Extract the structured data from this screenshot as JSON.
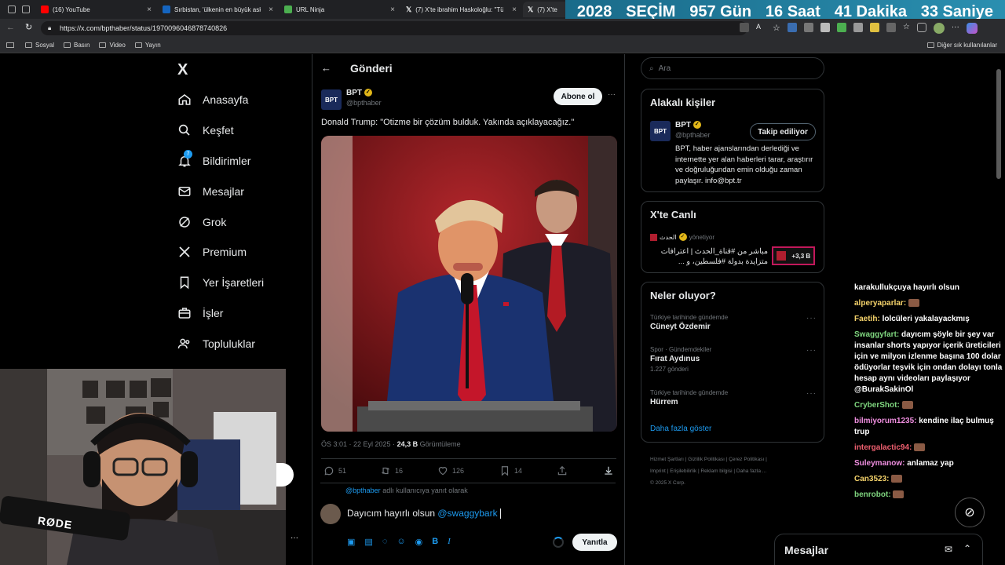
{
  "browser": {
    "tabs": [
      {
        "title": "(16) YouTube",
        "color": "#ff0000"
      },
      {
        "title": "Sırbistan, 'ülkenin en büyük askı",
        "color": "#1565c0"
      },
      {
        "title": "URL Ninja",
        "color": "#4caf50"
      },
      {
        "title": "(7) X'te ibrahim Haskoloğlu: \"Tü",
        "color": "#000000"
      },
      {
        "title": "(7) X'te",
        "color": "#000000"
      }
    ],
    "url": "https://x.com/bpthaber/status/1970096046878740826",
    "bookmarks": [
      "Sosyal",
      "Basın",
      "Video",
      "Yayın"
    ],
    "other_bookmarks": "Diğer sık kullanılanlar"
  },
  "countdown": {
    "year": "2028",
    "label": "SEÇİM",
    "days": "957 Gün",
    "hours": "16 Saat",
    "minutes": "41 Dakika",
    "seconds": "33 Saniye"
  },
  "nav": {
    "logo": "X",
    "items": [
      {
        "label": "Anasayfa",
        "icon": "home-icon"
      },
      {
        "label": "Keşfet",
        "icon": "search-icon"
      },
      {
        "label": "Bildirimler",
        "icon": "bell-icon",
        "badge": "7"
      },
      {
        "label": "Mesajlar",
        "icon": "mail-icon"
      },
      {
        "label": "Grok",
        "icon": "grok-icon"
      },
      {
        "label": "Premium",
        "icon": "x-icon"
      },
      {
        "label": "Yer İşaretleri",
        "icon": "bookmark-icon"
      },
      {
        "label": "İşler",
        "icon": "briefcase-icon"
      },
      {
        "label": "Topluluklar",
        "icon": "people-icon"
      }
    ]
  },
  "post": {
    "header_title": "Gönderi",
    "author_name": "BPT",
    "author_handle": "@bpthaber",
    "subscribe_label": "Abone ol",
    "text": "Donald Trump: \"Otizme bir çözüm bulduk. Yakında açıklayacağız.\"",
    "timestamp": "ÖS 3:01 · 22 Eyl 2025 · ",
    "views_count": "24,3 B",
    "views_label": "Görüntüleme",
    "replies": "51",
    "reposts": "16",
    "likes": "126",
    "bookmarks": "14"
  },
  "reply": {
    "replying_to": "@bpthaber",
    "replying_suffix": "adlı kullanıcıya yanıt olarak",
    "text": "Dayıcım hayırlı olsun ",
    "mention": "@swaggybark",
    "submit_label": "Yanıtla"
  },
  "sidebar": {
    "search_placeholder": "Ara",
    "related": {
      "title": "Alakalı kişiler",
      "name": "BPT",
      "handle": "@bpthaber",
      "follow_label": "Takip ediliyor",
      "bio": "BPT, haber ajanslarından derlediği ve internette yer alan haberleri tarar, araştırır ve doğruluğundan emin olduğu zaman paylaşır. info@bpt.tr"
    },
    "live": {
      "title": "X'te Canlı",
      "host": "الحدث",
      "host_suffix": "yönetiyor",
      "text": "مباشر من #قناة_الحدث | اعترافات متزايدة بدولة #فلسطين، و ...",
      "listeners": "+3,3 B"
    },
    "trends": {
      "title": "Neler oluyor?",
      "items": [
        {
          "meta": "Türkiye tarihinde gündemde",
          "name": "Cüneyt Özdemir",
          "count": ""
        },
        {
          "meta": "Spor · Gündemdekiler",
          "name": "Fırat Aydınus",
          "count": "1.227 gönderi"
        },
        {
          "meta": "Türkiye tarihinde gündemde",
          "name": "Hürrem",
          "count": ""
        }
      ],
      "show_more": "Daha fazla göster"
    },
    "footer": [
      "Hizmet Şartları",
      "Gizlilik Politikası",
      "Çerez Politikası",
      "Imprint",
      "Erişilebilirlik",
      "Reklam bilgisi",
      "Daha fazla ...",
      "© 2025 X Corp."
    ]
  },
  "chat": [
    {
      "user": "",
      "text": "karakullukçuya hayırlı olsun",
      "color": "#ffffff"
    },
    {
      "user": "alperyaparlar:",
      "text": "",
      "color": "#f5d36b",
      "emote": true
    },
    {
      "user": "Faetih:",
      "text": "lolcüleri yakalayackmış",
      "color": "#f5d36b"
    },
    {
      "user": "Swaggyfart:",
      "text": "dayıcım şöyle bir şey var insanlar shorts yapıyor içerik üreticileri için ve milyon izlenme başına 100 dolar ödüyorlar teşvik için ondan dolayı tonla hesap aynı videoları paylaşıyor @BurakSakinOl",
      "color": "#7fd67f"
    },
    {
      "user": "CryberShot:",
      "text": "",
      "color": "#7fd67f",
      "emote": true
    },
    {
      "user": "bilmiyorum1235:",
      "text": "kendine ilaç bulmuş trup",
      "color": "#f08fe0"
    },
    {
      "user": "intergalactic94:",
      "text": "",
      "color": "#f06070",
      "emote": true
    },
    {
      "user": "Suleymanow:",
      "text": "anlamaz yap",
      "color": "#f08fe0"
    },
    {
      "user": "Can3523:",
      "text": "",
      "color": "#f5d36b",
      "emote": true
    },
    {
      "user": "benrobot:",
      "text": "",
      "color": "#7fd67f",
      "emote": true
    }
  ],
  "messages_drawer": {
    "title": "Mesajlar"
  },
  "webcam": {
    "mic_brand": "RØDE"
  }
}
